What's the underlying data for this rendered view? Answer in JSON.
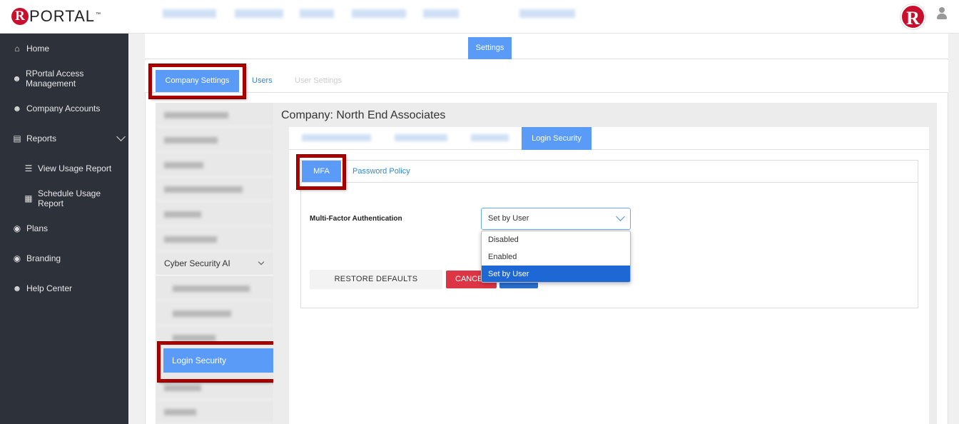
{
  "header": {
    "logo_r": "R",
    "logo_text": "PORTAL",
    "logo_tm": "™",
    "profile_r": "R"
  },
  "sidebar": {
    "items": [
      {
        "label": "Home",
        "icon": "home-icon"
      },
      {
        "label": "RPortal Access Management",
        "icon": "user-plus-icon"
      },
      {
        "label": "Company Accounts",
        "icon": "users-icon"
      },
      {
        "label": "Reports",
        "icon": "bar-chart-icon"
      },
      {
        "label": "View Usage Report",
        "icon": "list-icon"
      },
      {
        "label": "Schedule Usage Report",
        "icon": "calendar-icon"
      },
      {
        "label": "Plans",
        "icon": "lifebuoy-icon"
      },
      {
        "label": "Branding",
        "icon": "lifebuoy-icon"
      },
      {
        "label": "Help Center",
        "icon": "users-icon"
      }
    ]
  },
  "top_tabs": {
    "active": "Settings"
  },
  "settings_tabs": {
    "company_settings": "Company Settings",
    "users": "Users",
    "user_settings": "User Settings"
  },
  "subnav": {
    "cyber": "Cyber Security AI",
    "login_security": "Login Security"
  },
  "content": {
    "company_title": "Company: North End Associates",
    "active_tab": "Login Security",
    "mfa_tab": "MFA",
    "password_tab": "Password Policy",
    "mfa_label": "Multi-Factor Authentication",
    "mfa_value": "Set by User",
    "options": [
      "Disabled",
      "Enabled",
      "Set by User"
    ],
    "restore": "RESTORE DEFAULTS",
    "cancel": "CANCEL"
  },
  "colors": {
    "accent": "#5b9bf8",
    "sidebar_bg": "#2c313a",
    "brand_red": "#c8102e",
    "cancel": "#dc3545",
    "highlight_frame": "#aa0000"
  }
}
